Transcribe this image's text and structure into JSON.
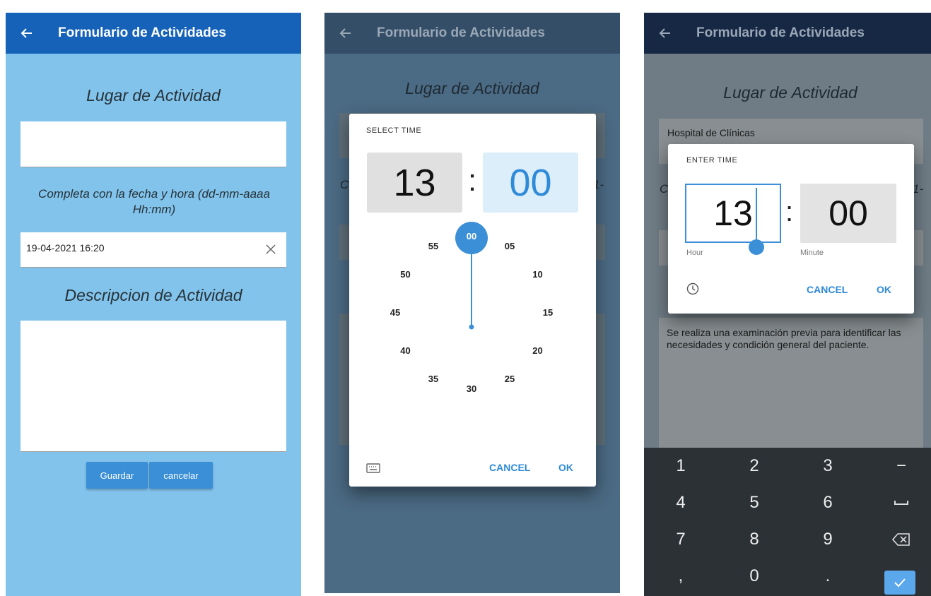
{
  "app": {
    "title": "Formulario de Actividades"
  },
  "form": {
    "place_heading": "Lugar de Actividad",
    "date_heading": "Completa con la  fecha y hora (dd-mm-aaaa Hh:mm)",
    "date_value": "19-04-2021 16:20",
    "desc_heading": "Descripcion de Actividad",
    "save_label": "Guardar",
    "cancel_label": "cancelar"
  },
  "clock_dialog": {
    "title": "SELECT TIME",
    "hour": "13",
    "separator": ":",
    "minute": "00",
    "dial": [
      "00",
      "05",
      "10",
      "15",
      "20",
      "25",
      "30",
      "35",
      "40",
      "45",
      "50",
      "55"
    ],
    "cancel": "CANCEL",
    "ok": "OK",
    "bg_fragment_left": "C",
    "bg_fragment_right": "1-"
  },
  "input_dialog": {
    "title": "ENTER TIME",
    "hour": "13",
    "separator": ":",
    "minute": "00",
    "hour_label": "Hour",
    "minute_label": "Minute",
    "cancel": "CANCEL",
    "ok": "OK",
    "place_value": "Hospital de Clínicas",
    "description": "Se realiza una examinación previa para identificar las necesidades y condición general del paciente.",
    "bg_fragment_left": "C",
    "bg_fragment_right": "1-"
  },
  "keyboard": {
    "keys": [
      "1",
      "2",
      "3",
      "−",
      "4",
      "5",
      "6",
      "␣",
      "7",
      "8",
      "9",
      "⌫",
      ",",
      "0",
      ".",
      "✓"
    ]
  },
  "colors": {
    "primary": "#1562b8",
    "accent": "#3a8fd6",
    "form_bg": "#82c3ec"
  },
  "icons": {
    "back": "arrow-left-icon",
    "clear": "close-icon",
    "keyboard": "keyboard-icon",
    "clock": "clock-icon",
    "backspace": "backspace-icon",
    "space": "space-icon",
    "confirm": "check-icon"
  }
}
